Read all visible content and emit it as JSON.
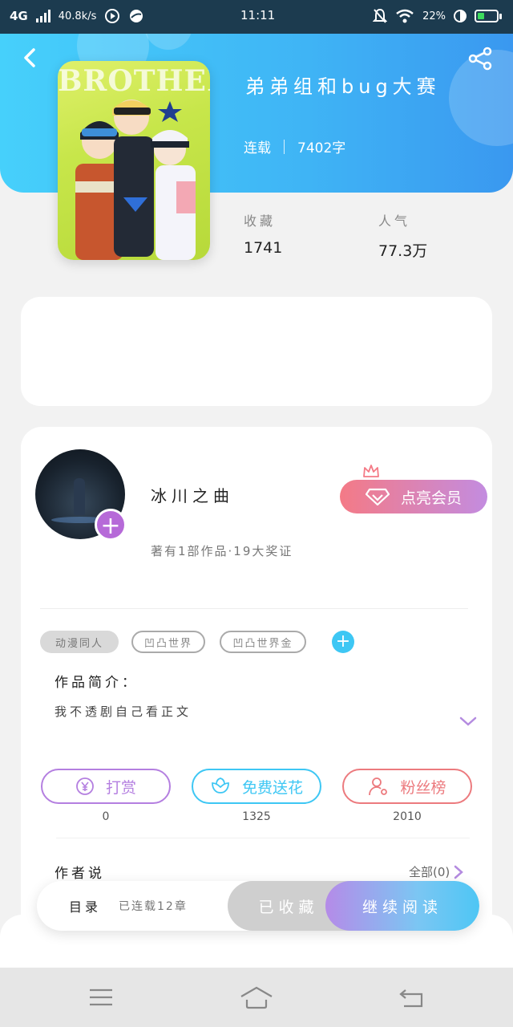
{
  "status": {
    "network": "4G",
    "speed": "40.8k/s",
    "time": "11:11",
    "battery": "22%"
  },
  "book": {
    "cover_title": "BROTHER",
    "title": "弟弟组和bug大赛",
    "status": "连载",
    "words": "7402字",
    "collect_label": "收藏",
    "collect_value": "1741",
    "popularity_label": "人气",
    "popularity_value": "77.3万"
  },
  "author": {
    "name": "冰川之曲",
    "subtitle": "著有1部作品·19大奖证",
    "vip_label": "点亮会员"
  },
  "tags": [
    "动漫同人",
    "凹凸世界",
    "凹凸世界金"
  ],
  "intro": {
    "title": "作品简介：",
    "text": "我不透剧自己看正文"
  },
  "actions": [
    {
      "label": "打赏",
      "count": "0",
      "color": "#b47fe0",
      "icon": "yen-icon"
    },
    {
      "label": "免费送花",
      "count": "1325",
      "color": "#3ec7f4",
      "icon": "flower-icon"
    },
    {
      "label": "粉丝榜",
      "count": "2010",
      "color": "#ec7a7e",
      "icon": "user-icon"
    }
  ],
  "author_say": {
    "title": "作者说",
    "all_label": "全部(0)"
  },
  "bottom_bar": {
    "catalog_label": "目录",
    "catalog_status": "已连载12章",
    "collected_label": "已收藏",
    "read_label": "继续阅读"
  }
}
